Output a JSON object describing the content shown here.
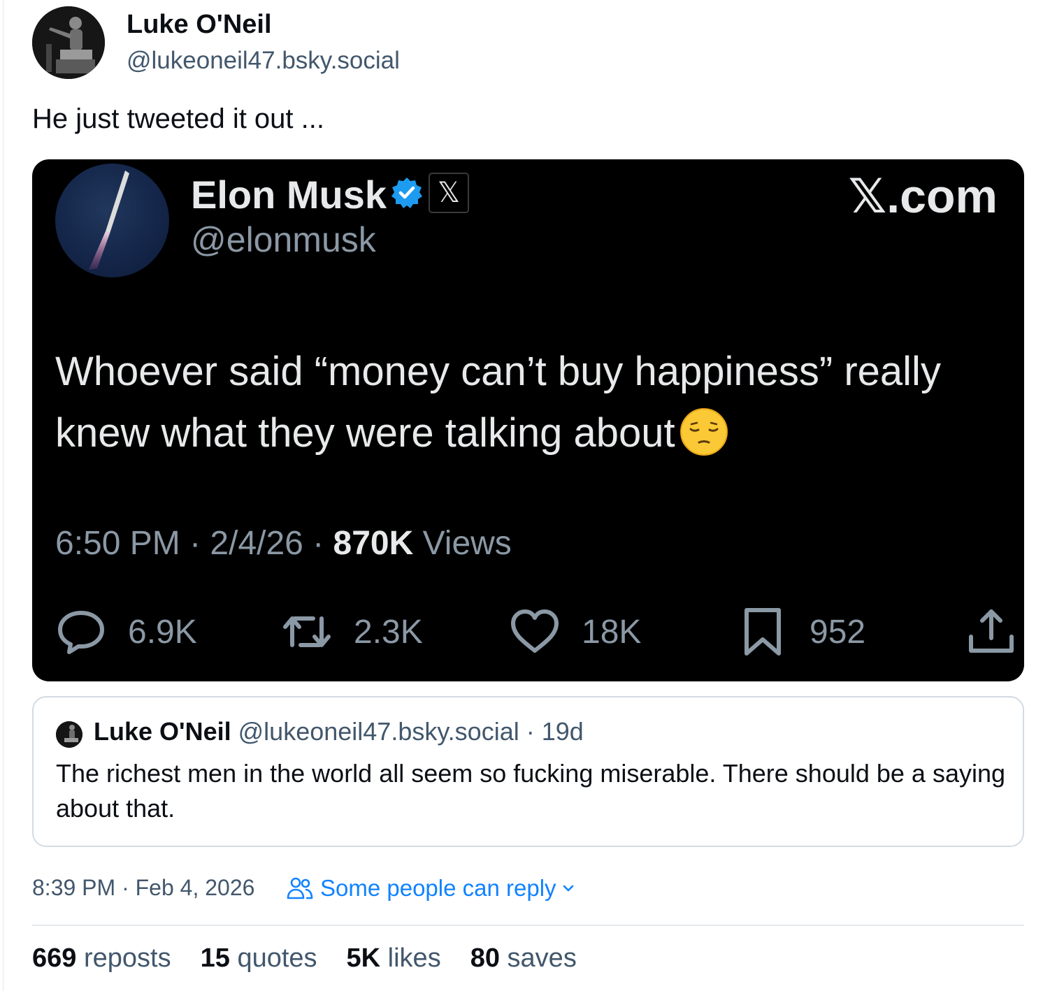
{
  "post": {
    "author_name": "Luke O'Neil",
    "author_handle": "@lukeoneil47.bsky.social",
    "text": "He just tweeted it out ..."
  },
  "embed_screenshot": {
    "display_name": "Elon Musk",
    "handle": "@elonmusk",
    "x_badge": "𝕏",
    "site_label": "𝕏.com",
    "text": "Whoever said “money can’t buy happiness” really knew what they were talking about",
    "time": "6:50 PM",
    "date": "2/4/26",
    "views_count": "870K",
    "views_label": "Views",
    "replies": "6.9K",
    "reposts": "2.3K",
    "likes": "18K",
    "bookmarks": "952",
    "icons": [
      "reply-icon",
      "repost-icon",
      "like-icon",
      "bookmark-icon",
      "share-icon"
    ]
  },
  "quoted_post": {
    "author_name": "Luke O'Neil",
    "author_handle": "@lukeoneil47.bsky.social",
    "age": "19d",
    "text": "The richest men in the world all seem so fucking miserable. There should be a saying about that."
  },
  "timestamp": "8:39 PM · Feb 4, 2026",
  "reply_setting": "Some people can reply",
  "stats": [
    {
      "count": "669",
      "label": "reposts"
    },
    {
      "count": "15",
      "label": "quotes"
    },
    {
      "count": "5K",
      "label": "likes"
    },
    {
      "count": "80",
      "label": "saves"
    }
  ],
  "colors": {
    "accent": "#1083fe",
    "muted": "#42576c",
    "text": "#0b0f14",
    "verified": "#1d9bf0"
  }
}
